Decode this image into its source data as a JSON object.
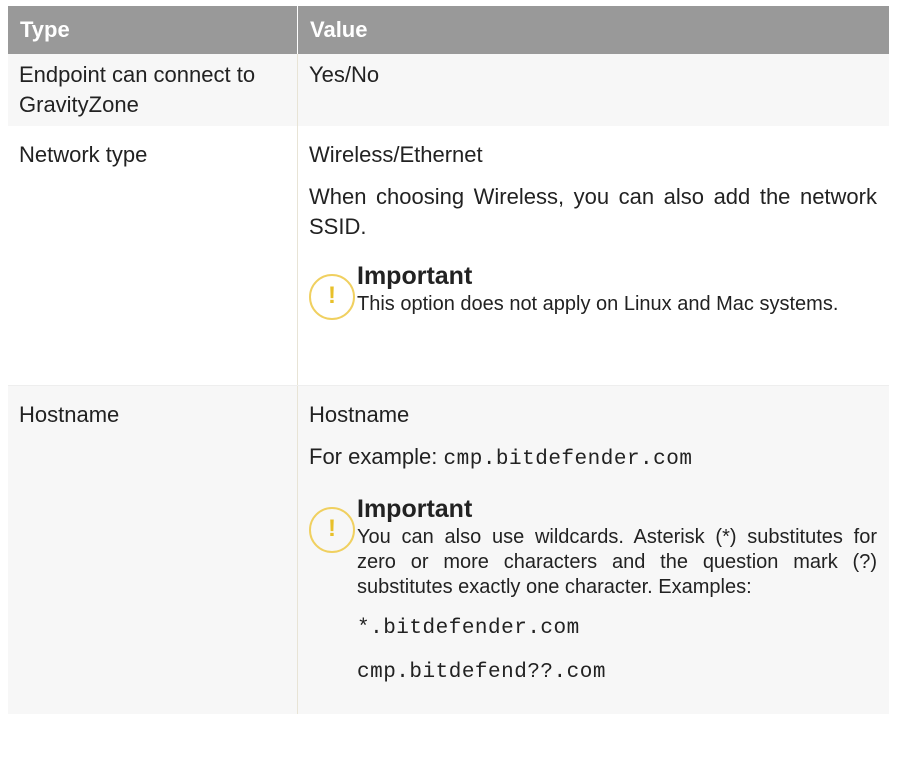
{
  "table": {
    "headers": {
      "type": "Type",
      "value": "Value"
    },
    "row1": {
      "type": "Endpoint can connect to GravityZone",
      "value": "Yes/No"
    },
    "row2": {
      "type": "Network type",
      "value": "Wireless/Ethernet",
      "description": "When choosing Wireless, you can also add the network SSID.",
      "note_icon": "exclamation-icon",
      "note_title": "Important",
      "note_text": "This option does not apply on Linux and Mac systems."
    },
    "row3": {
      "type": "Hostname",
      "value": "Hostname",
      "example_label": "For example:",
      "example_value": "cmp.bitdefender.com",
      "note_icon": "exclamation-icon",
      "note_title": "Important",
      "note_text": "You can also use wildcards. Asterisk (*) substitutes for zero or more characters and the question mark (?) substitutes exactly one character. Examples:",
      "code1": "*.bitdefender.com",
      "code2": "cmp.bitdefend??.com"
    }
  },
  "colors": {
    "header_bg": "#999999",
    "note_accent": "#f0d060"
  }
}
